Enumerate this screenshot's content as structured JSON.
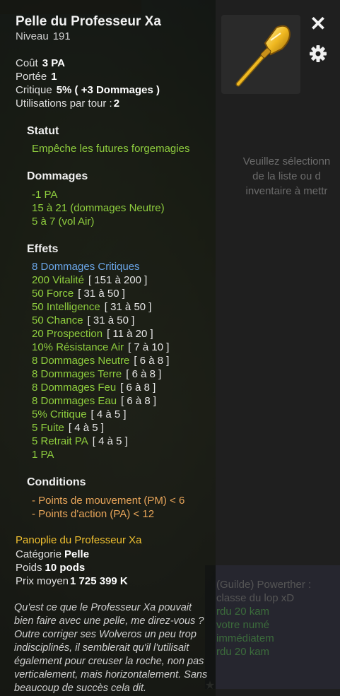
{
  "item": {
    "name": "Pelle du Professeur Xa",
    "level_label": "Niveau",
    "level_value": "191"
  },
  "stats": {
    "cost_label": "Coût",
    "cost_value": "3 PA",
    "range_label": "Portée",
    "range_value": "1",
    "critical_label": "Critique",
    "critical_value": "5% ( +3 Dommages )",
    "uses_label": "Utilisations par tour :",
    "uses_value": "2"
  },
  "statut": {
    "title": "Statut",
    "text": "Empêche les futures forgemagies"
  },
  "dommages": {
    "title": "Dommages",
    "lines": [
      "-1 PA",
      "15 à 21 (dommages Neutre)",
      "5 à 7 (vol Air)"
    ]
  },
  "effets": {
    "title": "Effets",
    "first": {
      "num": "8",
      "text": "Dommages Critiques"
    },
    "lines": [
      {
        "text": "200 Vitalité",
        "range": "[ 151 à 200 ]"
      },
      {
        "text": "50 Force",
        "range": "[ 31 à 50 ]"
      },
      {
        "text": "50 Intelligence",
        "range": "[ 31 à 50 ]"
      },
      {
        "text": "50 Chance",
        "range": "[ 31 à 50 ]"
      },
      {
        "text": "20 Prospection",
        "range": "[ 11 à 20 ]"
      },
      {
        "text": "10% Résistance Air",
        "range": "[ 7 à 10 ]"
      },
      {
        "text": "8 Dommages Neutre",
        "range": "[ 6 à 8 ]"
      },
      {
        "text": "8 Dommages Terre",
        "range": "[ 6 à 8 ]"
      },
      {
        "text": "8 Dommages Feu",
        "range": "[ 6 à 8 ]"
      },
      {
        "text": "8 Dommages Eau",
        "range": "[ 6 à 8 ]"
      },
      {
        "text": "5% Critique",
        "range": "[ 4 à 5 ]"
      },
      {
        "text": "5 Fuite",
        "range": "[ 4 à 5 ]"
      },
      {
        "text": "5 Retrait PA",
        "range": "[ 4 à 5 ]"
      },
      {
        "text": "1 PA",
        "range": ""
      }
    ]
  },
  "conditions": {
    "title": "Conditions",
    "lines": [
      "- Points de mouvement (PM) < 6",
      "- Points d'action (PA) < 12"
    ]
  },
  "set_name": "Panoplie du Professeur Xa",
  "info": {
    "category_label": "Catégorie",
    "category_value": "Pelle",
    "weight_label": "Poids",
    "weight_value": "10 pods",
    "price_label": "Prix moyen",
    "price_value": "1 725 399 K"
  },
  "description": "Qu'est ce que le Professeur Xa pouvait bien faire avec une pelle, me direz-vous ? Outre corriger ses Wolveros un peu trop indisciplinés, il semblerait qu'il l'utilisait également pour creuser la roche, non pas verticalement, mais horizontalement. Sans beaucoup de succès cela dit.",
  "right_panel": {
    "hint": "Veuillez sélectionn de la liste ou d inventaire à mettr"
  },
  "chat": {
    "line1": "(Guilde) Powerther :",
    "line2": "classe du lop xD",
    "line3": "rdu 20 kam",
    "line4": "votre numé",
    "line5": "immédiatem",
    "line6": "rdu 20 kam"
  },
  "icons": {
    "close": "close-icon",
    "settings": "gear-icon",
    "item": "shovel-icon",
    "star": "star-icon"
  },
  "colors": {
    "effect_green": "#8fce3e",
    "critical_blue": "#6aa6e8",
    "condition_orange": "#e8a55a",
    "set_gold": "#f0c030"
  }
}
